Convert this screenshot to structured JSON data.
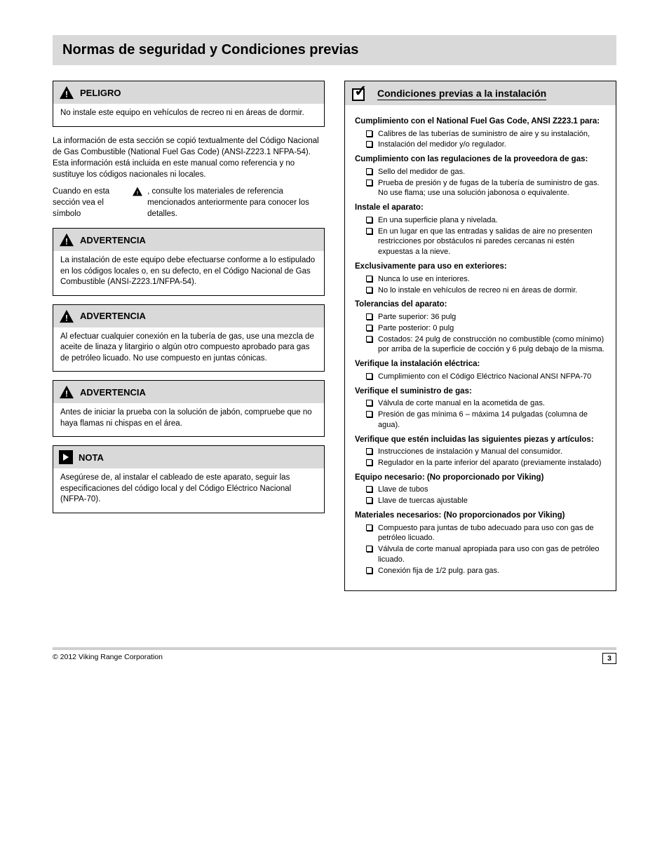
{
  "title": "Normas de seguridad y Condiciones previas",
  "left": {
    "box1": {
      "label": "PELIGRO",
      "body": "No instale este equipo en vehículos de recreo ni en áreas de dormir."
    },
    "intro1": "La información de esta sección se copió textualmente del Código Nacional de Gas Combustible (National Fuel Gas Code) (ANSI-Z223.1 NFPA-54). Esta información está incluida en este manual como referencia y no sustituye los códigos nacionales ni locales.",
    "intro2_prefix": "Cuando en esta sección vea el símbolo",
    "intro2_suffix": ", consulte los materiales de referencia mencionados anteriormente para conocer los detalles.",
    "box2": {
      "label": "ADVERTENCIA",
      "body": "La instalación de este equipo debe efectuarse conforme a lo estipulado en los códigos locales o, en su defecto, en el Código Nacional de Gas Combustible (ANSI-Z223.1/NFPA-54)."
    },
    "box3": {
      "label": "ADVERTENCIA",
      "body": "Al efectuar cualquier conexión en la tubería de gas, use una mezcla de aceite de linaza y litargirio o algún otro compuesto aprobado para gas de petróleo licuado. No use compuesto en juntas cónicas."
    },
    "box4": {
      "label": "ADVERTENCIA",
      "body": "Antes de iniciar la prueba con la solución de jabón, compruebe que no haya flamas ni chispas en el área."
    },
    "box5": {
      "label": "NOTA",
      "body": "Asegúrese de, al instalar el cableado de este aparato, seguir las especificaciones del código local y del Código Eléctrico Nacional (NFPA-70)."
    }
  },
  "right": {
    "title": "Condiciones previas a la instalación",
    "groups": [
      {
        "title": "Cumplimiento con el National Fuel Gas Code, ANSI Z223.1 para:",
        "items": [
          "Calibres de las tuberías de suministro de aire y su instalación,",
          "Instalación del medidor y/o regulador."
        ]
      },
      {
        "title": "Cumplimiento con las regulaciones de la proveedora de gas:",
        "items": [
          "Sello del medidor de gas.",
          "Prueba de presión y de fugas de la tubería de suministro de gas. No use flama; use una solución jabonosa o equivalente."
        ]
      },
      {
        "title": "Instale el aparato:",
        "items": [
          "En una superficie plana y nivelada.",
          "En un lugar en que las entradas y salidas de aire no presenten restricciones por obstáculos ni paredes cercanas ni estén expuestas a la nieve."
        ]
      },
      {
        "title": "Exclusivamente para uso en exteriores:",
        "items": [
          "Nunca lo use en interiores.",
          "No lo instale en vehículos de recreo ni en áreas de dormir."
        ]
      },
      {
        "title": "Tolerancias del aparato:",
        "items": [
          "Parte superior: 36 pulg",
          "Parte posterior: 0 pulg",
          "Costados: 24 pulg de construcción no combustible (como mínimo) por arriba de la superficie de cocción y 6 pulg debajo de la misma."
        ]
      },
      {
        "title": "Verifique la instalación eléctrica:",
        "items": [
          "Cumplimiento con el Código Eléctrico Nacional ANSI NFPA-70"
        ]
      },
      {
        "title": "Verifique el suministro de gas:",
        "items": [
          "Válvula de corte manual en la acometida de gas.",
          "Presión de gas mínima 6 – máxima 14 pulgadas (columna de agua)."
        ]
      },
      {
        "title": "Verifique que estén incluidas las siguientes piezas y artículos:",
        "items": [
          "Instrucciones de instalación y Manual del consumidor.",
          "Regulador en la parte inferior del aparato (previamente instalado)"
        ]
      },
      {
        "title": "Equipo necesario: (No proporcionado por Viking)",
        "items": [
          "Llave de tubos",
          "Llave de tuercas ajustable"
        ]
      },
      {
        "title": "Materiales necesarios: (No proporcionados por Viking)",
        "items": [
          "Compuesto para juntas de tubo adecuado para uso con gas de petróleo licuado.",
          "Válvula de corte manual apropiada para uso con gas de petróleo licuado.",
          "Conexión fija de 1/2 pulg. para gas."
        ]
      }
    ]
  },
  "footer": {
    "left": "© 2012 Viking Range Corporation",
    "page": "3"
  }
}
